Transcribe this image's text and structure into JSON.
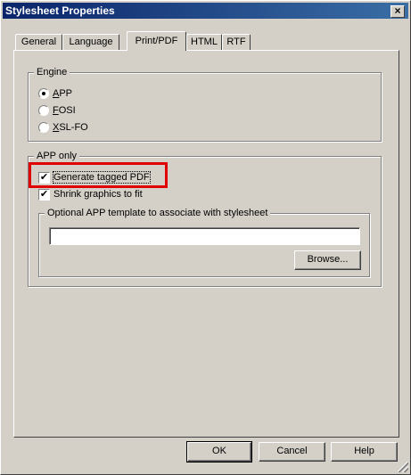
{
  "window": {
    "title": "Stylesheet Properties",
    "close_glyph": "×"
  },
  "tabs": [
    {
      "label": "General"
    },
    {
      "label": "Language"
    },
    {
      "label": "Print/PDF"
    },
    {
      "label": "HTML"
    },
    {
      "label": "RTF"
    }
  ],
  "engine": {
    "group_label": "Engine",
    "options": [
      {
        "label": "APP",
        "mnemonic": "A",
        "rest": "PP",
        "selected": true
      },
      {
        "label": "FOSI",
        "mnemonic": "F",
        "rest": "OSI",
        "selected": false
      },
      {
        "label": "XSL-FO",
        "mnemonic": "X",
        "rest": "SL-FO",
        "selected": false
      }
    ]
  },
  "app_only": {
    "group_label": "APP only",
    "generate_tagged_pdf": {
      "label": "Generate tagged PDF",
      "checked": true
    },
    "shrink_graphics": {
      "label": "Shrink graphics to fit",
      "checked": true
    },
    "template_group": {
      "group_label": "Optional APP template to associate with stylesheet",
      "value": "",
      "browse_label": "Browse..."
    }
  },
  "buttons": {
    "ok": "OK",
    "cancel": "Cancel",
    "help": "Help"
  },
  "colors": {
    "highlight": "#e00000",
    "title_bar": "#0a246a"
  }
}
